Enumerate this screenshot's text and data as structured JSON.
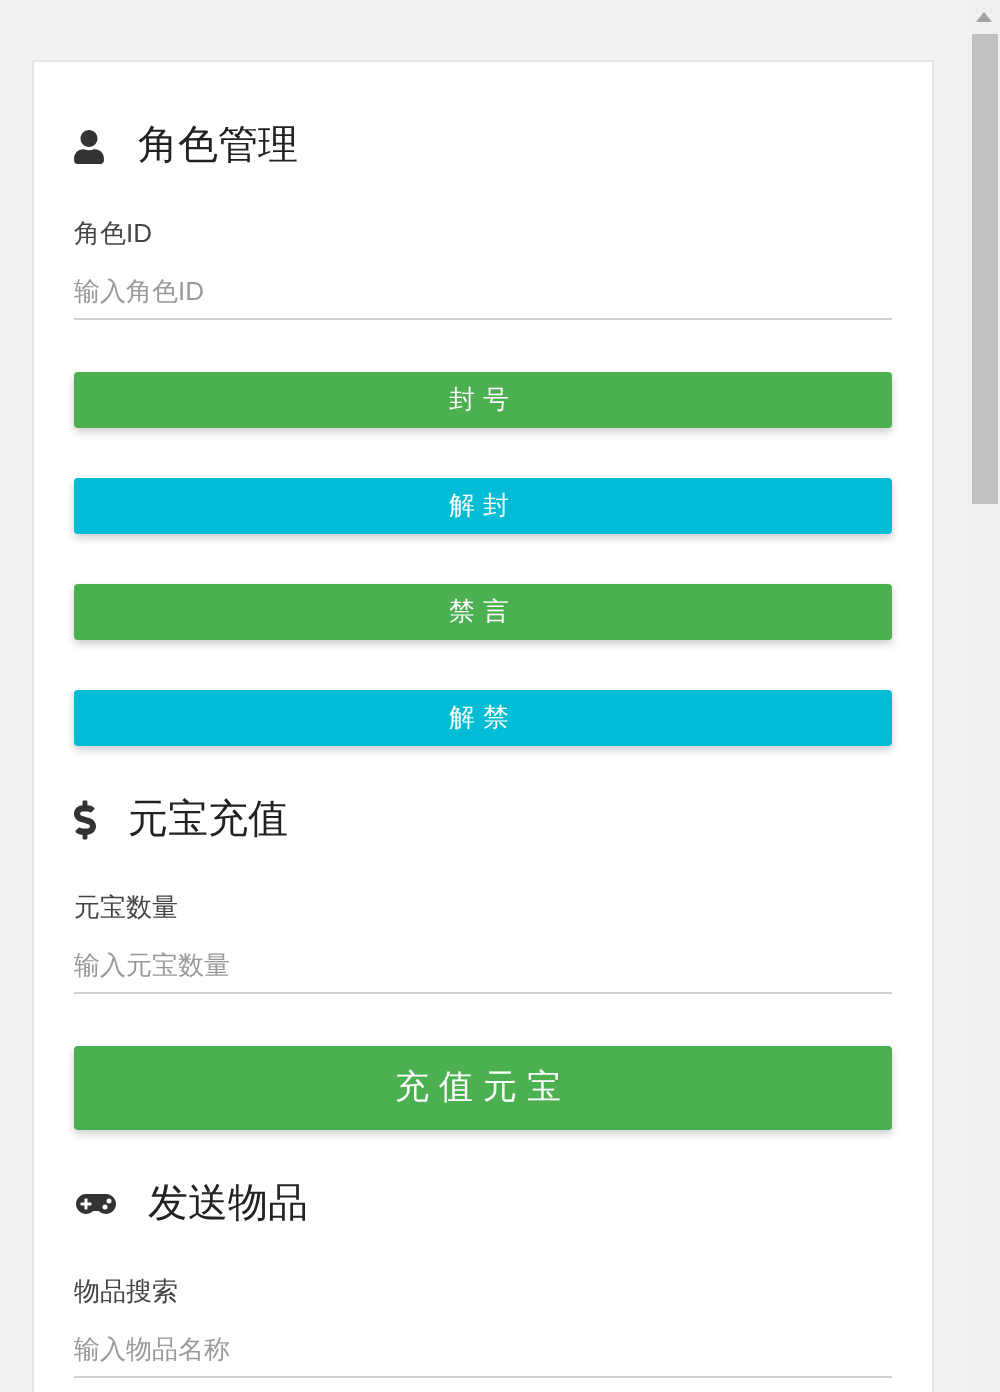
{
  "sections": [
    {
      "heading": "角色管理",
      "field": {
        "label": "角色ID",
        "placeholder": "输入角色ID"
      },
      "buttons": [
        {
          "label": "封号",
          "color": "#4caf50",
          "kind": "small"
        },
        {
          "label": "解封",
          "color": "#00bcd4",
          "kind": "small"
        },
        {
          "label": "禁言",
          "color": "#4caf50",
          "kind": "small"
        },
        {
          "label": "解禁",
          "color": "#00bcd4",
          "kind": "small"
        }
      ]
    },
    {
      "heading": "元宝充值",
      "field": {
        "label": "元宝数量",
        "placeholder": "输入元宝数量"
      },
      "buttons": [
        {
          "label": "充值元宝",
          "color": "#4caf50",
          "kind": "large"
        }
      ]
    },
    {
      "heading": "发送物品",
      "field": {
        "label": "物品搜索",
        "placeholder": "输入物品名称"
      }
    }
  ]
}
